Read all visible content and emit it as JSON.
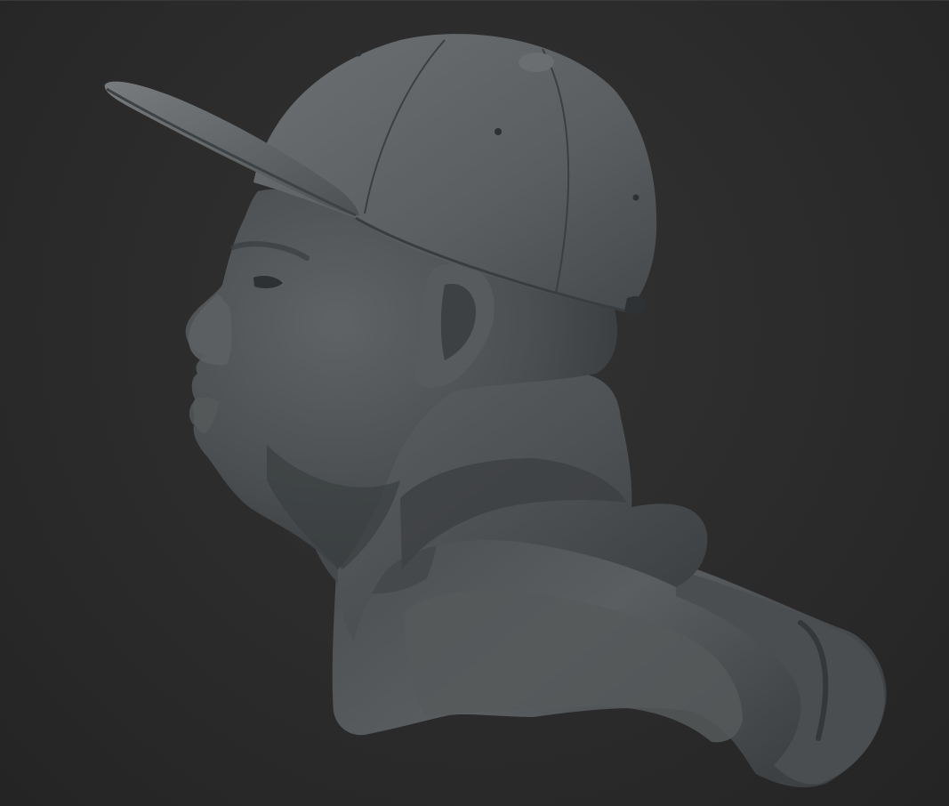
{
  "scene": {
    "subject": "sculpt-bust",
    "view": "side-profile-left",
    "colors": {
      "background": "#2a2a2a",
      "clay_light": "#6f7375",
      "clay_mid": "#54585a",
      "clay_dark": "#3a3d3f",
      "clay_shadow": "#2c2e30"
    }
  }
}
